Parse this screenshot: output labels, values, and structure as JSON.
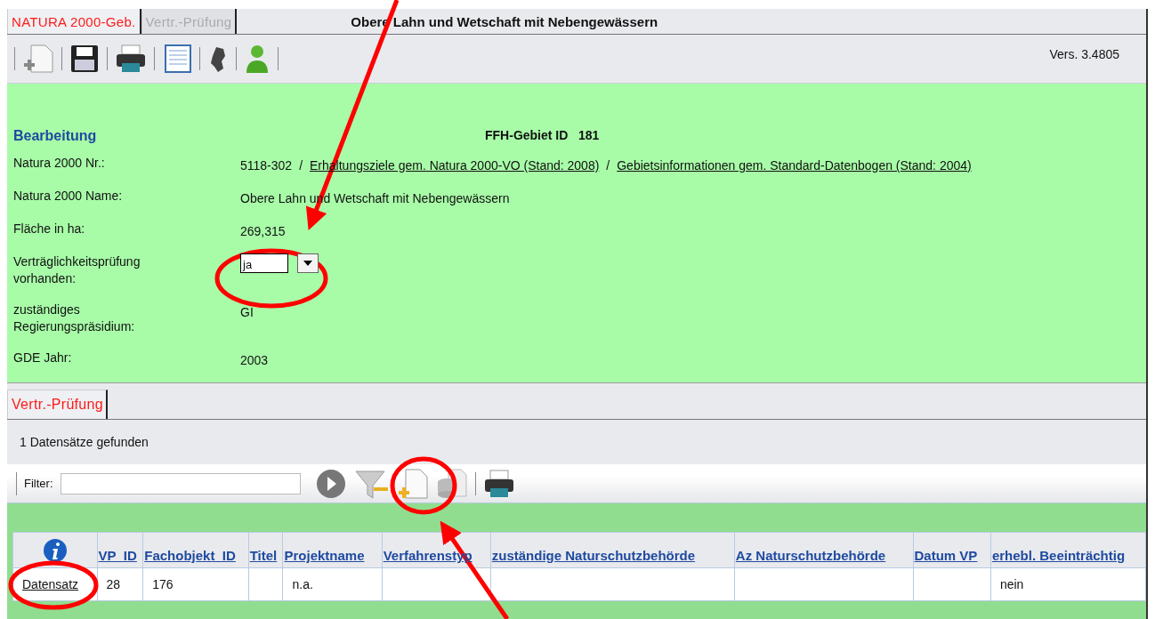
{
  "tabs": [
    {
      "label": "NATURA 2000-Geb.",
      "selected": true
    },
    {
      "label": "Vertr.-Prüfung",
      "selected": false
    }
  ],
  "window": {
    "title": "Obere Lahn und Wetschaft mit Nebengewässern"
  },
  "toolbar": {
    "version": "Vers. 3.4805"
  },
  "form": {
    "section": "Bearbeitung",
    "heading": "FFH-Gebiet ID",
    "id": "181",
    "fields": [
      {
        "kind": "links",
        "label": "Natura 2000 Nr.:",
        "value": "5118-302",
        "links": [
          "Erhaltungsziele gem. Natura 2000-VO (Stand: 2008)",
          "Gebietsinformationen gem. Standard-Datenbogen (Stand: 2004)"
        ],
        "separator": "/"
      },
      {
        "kind": "text",
        "label": "Natura 2000 Name:",
        "value": "Obere Lahn und Wetschaft mit Nebengewässern"
      },
      {
        "kind": "text",
        "label": "Fläche in ha:",
        "value": "269,315"
      },
      {
        "kind": "select",
        "label": "Verträglichkeitsprüfung vorhanden:",
        "value": "ja"
      },
      {
        "kind": "text",
        "label": "zuständiges Regierungspräsidium:",
        "value": "GI"
      },
      {
        "kind": "text",
        "label": "GDE Jahr:",
        "value": "2003"
      }
    ]
  },
  "lower_tabs": [
    {
      "label": "Vertr.-Prüfung",
      "selected": true
    }
  ],
  "result_count": "1 Datensätze gefunden",
  "filter": {
    "label": "Filter:"
  },
  "table": {
    "columns": [
      "VP_ID",
      "Fachobjekt_ID",
      "Titel",
      "Projektname",
      "Verfahrenstyp",
      "zuständige Naturschutzbehörde",
      "Az Naturschutzbehörde",
      "Datum VP",
      "erhebl. Beeinträchtig"
    ],
    "rows": [
      {
        "link": "Datensatz",
        "cells": [
          "28",
          "176",
          null,
          "n.a.",
          null,
          null,
          null,
          null,
          "nein"
        ]
      }
    ]
  }
}
